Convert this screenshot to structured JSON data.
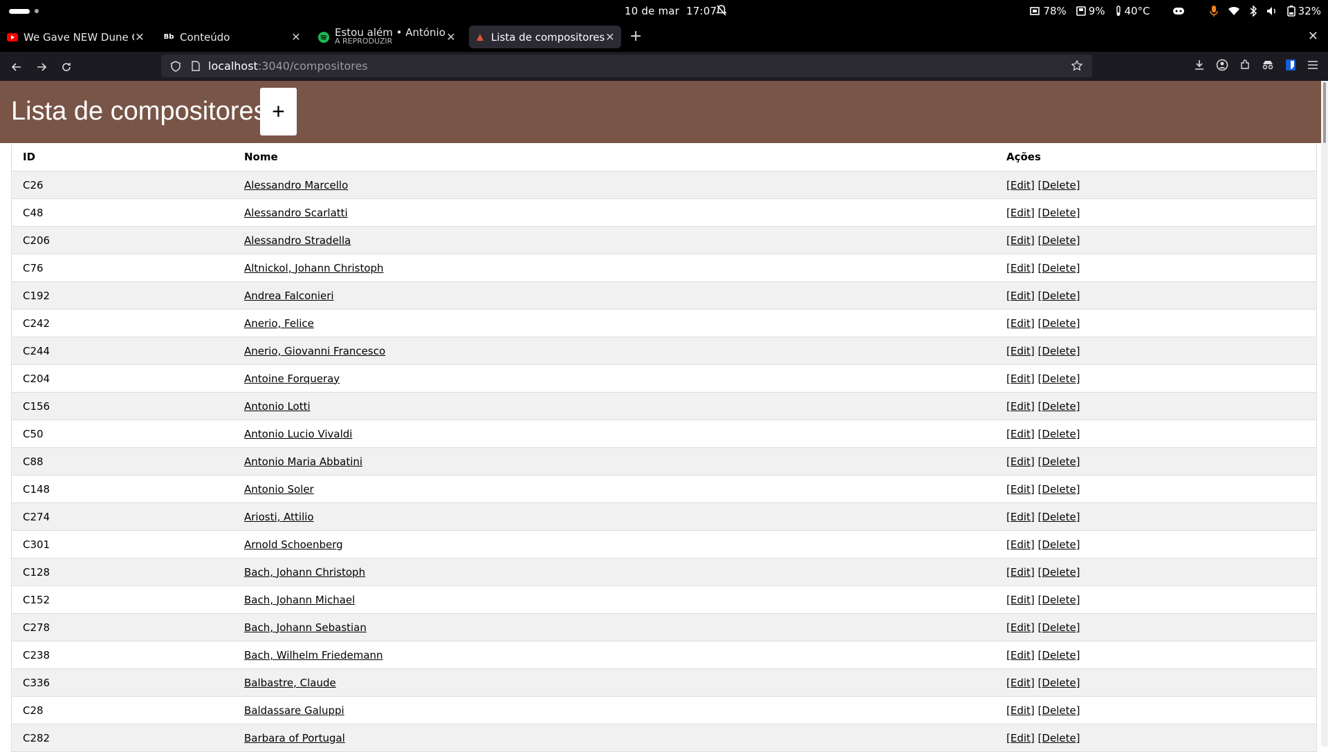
{
  "system": {
    "date": "10 de mar",
    "time": "17:07",
    "indicators": {
      "cpu": "78%",
      "disk": "9%",
      "temperature": "40°C",
      "battery": "32%"
    }
  },
  "tabs": [
    {
      "title": "We Gave NEW Dune OLD",
      "subtitle": "",
      "favicon": "youtube-icon",
      "active": false
    },
    {
      "title": "Conteúdo",
      "subtitle": "",
      "favicon": "blackboard-icon",
      "active": false
    },
    {
      "title": "Estou além • António Vari",
      "subtitle": "A REPRODUZIR",
      "favicon": "spotify-icon",
      "active": false
    },
    {
      "title": "Lista de compositores",
      "subtitle": "",
      "favicon": "app-icon",
      "active": true
    }
  ],
  "urlbar": {
    "host": "localhost",
    "path": ":3040/compositores"
  },
  "page": {
    "title": "Lista de compositores",
    "add_label": "+",
    "colors": {
      "header_bg": "#795548",
      "row_alt": "#f1f1f1"
    }
  },
  "table": {
    "headers": {
      "id": "ID",
      "nome": "Nome",
      "acoes": "Ações"
    },
    "edit_label": "[Edit]",
    "delete_label": "[Delete]",
    "rows": [
      {
        "id": "C26",
        "nome": "Alessandro Marcello"
      },
      {
        "id": "C48",
        "nome": "Alessandro Scarlatti"
      },
      {
        "id": "C206",
        "nome": "Alessandro Stradella"
      },
      {
        "id": "C76",
        "nome": "Altnickol, Johann Christoph"
      },
      {
        "id": "C192",
        "nome": "Andrea Falconieri"
      },
      {
        "id": "C242",
        "nome": "Anerio, Felice"
      },
      {
        "id": "C244",
        "nome": "Anerio, Giovanni Francesco"
      },
      {
        "id": "C204",
        "nome": "Antoine Forqueray"
      },
      {
        "id": "C156",
        "nome": "Antonio Lotti"
      },
      {
        "id": "C50",
        "nome": "Antonio Lucio Vivaldi"
      },
      {
        "id": "C88",
        "nome": "Antonio Maria Abbatini"
      },
      {
        "id": "C148",
        "nome": "Antonio Soler"
      },
      {
        "id": "C274",
        "nome": "Ariosti, Attilio"
      },
      {
        "id": "C301",
        "nome": "Arnold Schoenberg"
      },
      {
        "id": "C128",
        "nome": "Bach, Johann Christoph"
      },
      {
        "id": "C152",
        "nome": "Bach, Johann Michael"
      },
      {
        "id": "C278",
        "nome": "Bach, Johann Sebastian"
      },
      {
        "id": "C238",
        "nome": "Bach, Wilhelm Friedemann"
      },
      {
        "id": "C336",
        "nome": "Balbastre, Claude"
      },
      {
        "id": "C28",
        "nome": "Baldassare Galuppi"
      },
      {
        "id": "C282",
        "nome": "Barbara of Portugal"
      }
    ]
  }
}
